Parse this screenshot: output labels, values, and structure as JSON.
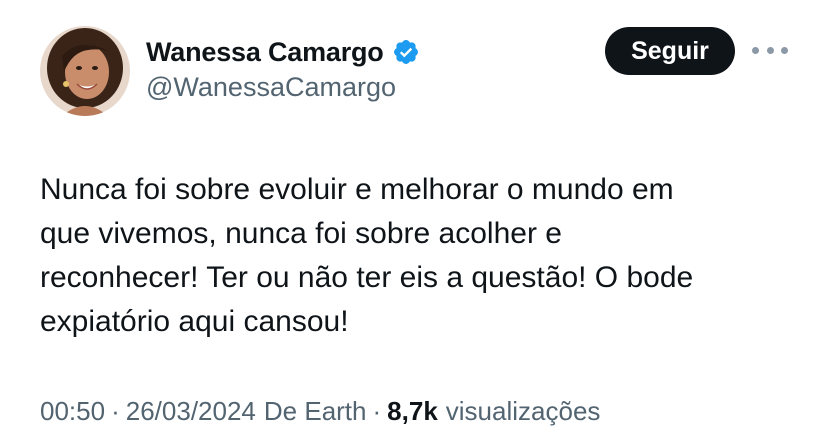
{
  "author": {
    "display_name": "Wanessa Camargo",
    "handle": "@WanessaCamargo",
    "verified": true,
    "avatar_icon": "profile-photo"
  },
  "actions": {
    "follow_label": "Seguir",
    "more_icon": "more-horizontal-icon"
  },
  "tweet": {
    "text": "Nunca foi sobre evoluir e melhorar o mundo em\nque vivemos, nunca foi sobre acolher e\nreconhecer! Ter ou não ter eis a questão! O bode\nexpiatório aqui cansou!"
  },
  "meta": {
    "time": "00:50",
    "separator": "·",
    "date": "26/03/2024",
    "source": "De Earth",
    "views_count": "8,7k",
    "views_label": "visualizações"
  },
  "colors": {
    "text": "#0f1419",
    "secondary": "#536471",
    "verified_blue": "#1d9bf0",
    "button_bg": "#0f1419"
  }
}
